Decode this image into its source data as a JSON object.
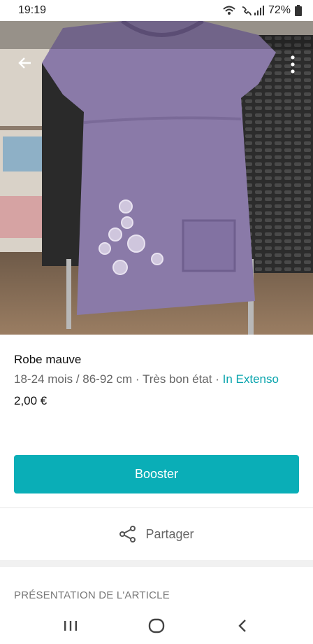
{
  "status_bar": {
    "time": "19:19",
    "battery": "72%",
    "icons": [
      "wifi-calling-icon",
      "signal-icon",
      "battery-icon"
    ]
  },
  "photo": {
    "description_icons": [
      "back-arrow-icon",
      "more-vert-icon"
    ]
  },
  "item": {
    "title": "Robe mauve",
    "size": "18-24 mois / 86-92 cm",
    "condition": "Très bon état",
    "brand": "In Extenso",
    "price": "2,00 €"
  },
  "actions": {
    "booster_label": "Booster",
    "share_label": "Partager"
  },
  "section": {
    "title": "PRÉSENTATION DE L'ARTICLE"
  },
  "nav": {
    "buttons": [
      "recent-apps-icon",
      "home-icon",
      "back-icon"
    ]
  },
  "colors": {
    "accent": "#0aaeb7",
    "link": "#09a4ad",
    "dress": "#8a7aa8"
  }
}
